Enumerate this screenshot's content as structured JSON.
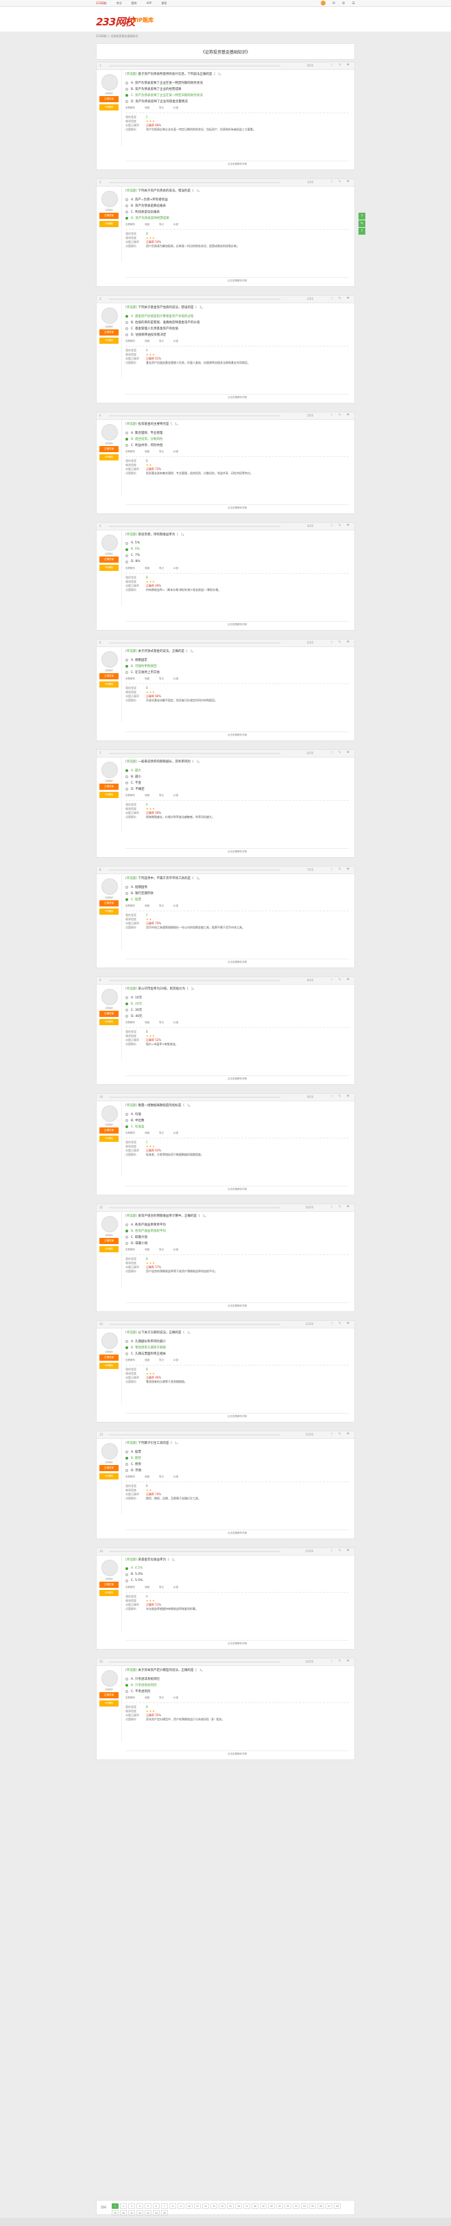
{
  "topbar": {
    "links": [
      "233网校",
      "考试",
      "题库",
      "APP",
      "课程"
    ],
    "active_index": 0
  },
  "header": {
    "logo": "233网校",
    "sublogo": "VIP题库"
  },
  "breadcrumb": "233网校 > 证券投资基金基础知识",
  "paper_title": "《证券投资基金基础知识》",
  "side_tools": [
    "↑",
    "✎",
    "?"
  ],
  "colors": {
    "brand": "#d6281c",
    "accent": "#ff7a00",
    "correct": "#4aa53a"
  },
  "labels": {
    "my_answer": "我的答案",
    "difficulty": "难易程度",
    "analysis": "试题解析",
    "correct_rate": "本题正确率",
    "view_analysis": "查看解析",
    "collect": "收藏",
    "note": "笔记",
    "error": "纠错",
    "more": "点击查看解析详情",
    "pages": "页码",
    "badge1": "正确答案",
    "badge2": "VIP解析"
  },
  "questions": [
    {
      "no": "1",
      "count": "0/50",
      "type": "[单选题]",
      "title": "基于资产负债表所提供的会计信息，下列说法正确的是（　）。",
      "options": [
        "A. 资产负债表反映了企业在某一特定时期的财务状况",
        "B. 资产负债表反映了企业的经营成果",
        "C. 资产负债表反映了企业在某一特定日期的财务状况",
        "D. 资产负债表反映了企业的现金流量情况"
      ],
      "correct": 2,
      "answer": "C",
      "stars": "★★★",
      "rate": "正确率 68%",
      "analysis": "资产负债表反映企业在某一特定日期的财务状况，包括资产、负债和所有者权益三大要素。"
    },
    {
      "no": "2",
      "count": "1/50",
      "type": "[单选题]",
      "title": "下列关于资产负债表的说法，错误的是（　）。",
      "options": [
        "A. 资产=负债+所有者权益",
        "B. 资产负债表是静态报表",
        "C. 利润表是动态报表",
        "D. 资产负债表反映经营成果"
      ],
      "correct": 3,
      "answer": "D",
      "stars": "★★★",
      "rate": "正确率 54%",
      "analysis": "资产负债表为静态报表，反映某一时点的财务状况；经营成果由利润表反映。"
    },
    {
      "no": "3",
      "count": "2/50",
      "type": "[单选题]",
      "title": "下列关于基金资产估值的说法，错误的是（　）。",
      "options": [
        "A. 基金资产估值是指计算基金资产净值的过程",
        "B. 估值的目的是客观、准确地反映基金资产的价值",
        "C. 基金管理人负责基金资产的估值",
        "D. 估值频率由投资者决定"
      ],
      "correct": 0,
      "answer": "A",
      "stars": "★★★",
      "rate": "正确率 61%",
      "analysis": "基金资产估值由基金管理人负责，托管人复核，估值频率由相关法规和基金合同规定。"
    },
    {
      "no": "4",
      "count": "3/50",
      "type": "[单选题]",
      "title": "投资基金的主要特点是（　）。",
      "options": [
        "A. 集合理财、专业管理",
        "B. 组合投资、分散风险",
        "C. 利益共享、风险共担"
      ],
      "correct": 1,
      "answer": "B",
      "stars": "★★",
      "rate": "正确率 72%",
      "analysis": "投资基金具有集合理财、专业管理，组合投资、分散风险，利益共享、风险共担等特点。"
    },
    {
      "no": "5",
      "count": "4/50",
      "type": "[单选题]",
      "title": "某投资者，持有期收益率为（　）。",
      "options": [
        "A. 5%",
        "B. 6%",
        "C. 7%",
        "D. 8%"
      ],
      "correct": 1,
      "answer": "B",
      "stars": "★★★",
      "rate": "正确率 49%",
      "analysis": "持有期收益率=（期末价格-期初价格+现金收益）/期初价格。"
    },
    {
      "no": "6",
      "count": "5/50",
      "type": "[单选题]",
      "title": "关于开放式基金的说法，正确的是（　）。",
      "options": [
        "A. 规模固定",
        "B. 可随时申购赎回",
        "C. 在交易所上市交易"
      ],
      "correct": 1,
      "answer": "B",
      "stars": "★★★",
      "rate": "正确率 66%",
      "analysis": "开放式基金份额不固定，投资者可在规定时间内申购赎回。"
    },
    {
      "no": "7",
      "count": "6/50",
      "type": "[单选题]",
      "title": "一般来说债券的期限越长，其利率风险（　）。",
      "options": [
        "A. 越大",
        "B. 越小",
        "C. 不变",
        "D. 不确定"
      ],
      "correct": 0,
      "answer": "A",
      "stars": "★★★",
      "rate": "正确率 58%",
      "analysis": "债券期限越长，价格对利率变动越敏感，利率风险越大。"
    },
    {
      "no": "8",
      "count": "7/50",
      "type": "[单选题]",
      "title": "下列选项中，不属于货币市场工具的是（　）。",
      "options": [
        "A. 短期国债",
        "B. 银行定期存款",
        "C. 股票"
      ],
      "correct": 2,
      "answer": "C",
      "stars": "★★",
      "rate": "正确率 70%",
      "analysis": "货币市场工具通常指期限在一年以内的短期金融工具，股票不属于货币市场工具。"
    },
    {
      "no": "9",
      "count": "8/50",
      "type": "[单选题]",
      "title": "某公司市盈率为20倍，则其股价为（　）。",
      "options": [
        "A. 10元",
        "B. 20元",
        "C. 30元",
        "D. 40元"
      ],
      "correct": 1,
      "answer": "B",
      "stars": "★★★",
      "rate": "正确率 52%",
      "analysis": "股价=市盈率×每股收益。"
    },
    {
      "no": "10",
      "count": "9/50",
      "type": "[单选题]",
      "title": "衡量一组数据离散程度的指标是（　）。",
      "options": [
        "A. 均值",
        "B. 中位数",
        "C. 标准差"
      ],
      "correct": 2,
      "answer": "C",
      "stars": "★★★",
      "rate": "正确率 63%",
      "analysis": "标准差、方差等指标用于衡量数据的离散程度。"
    },
    {
      "no": "11",
      "count": "10/50",
      "type": "[单选题]",
      "title": "某资产组合的预期收益率计算中，正确的是（　）。",
      "options": [
        "A. 各资产收益率简单平均",
        "B. 各资产收益率加权平均",
        "C. 取最大值",
        "D. 取最小值"
      ],
      "correct": 1,
      "answer": "B",
      "stars": "★★★",
      "rate": "正确率 57%",
      "analysis": "资产组合的预期收益率等于各资产预期收益率的加权平均。"
    },
    {
      "no": "12",
      "count": "11/50",
      "type": "[单选题]",
      "title": "以下关于久期的说法，正确的是（　）。",
      "options": [
        "A. 久期越长利率风险越小",
        "B. 零息债券久期等于期限",
        "C. 久期与票面利率正相关"
      ],
      "correct": 1,
      "answer": "B",
      "stars": "★★★",
      "rate": "正确率 46%",
      "analysis": "零息债券的久期等于其到期期限。"
    },
    {
      "no": "13",
      "count": "12/50",
      "type": "[单选题]",
      "title": "下列属于衍生工具的是（　）。",
      "options": [
        "A. 股票",
        "B. 期货",
        "C. 债券",
        "D. 存款"
      ],
      "correct": 1,
      "answer": "B",
      "stars": "★★",
      "rate": "正确率 74%",
      "analysis": "期货、期权、远期、互换属于金融衍生工具。"
    },
    {
      "no": "14",
      "count": "13/50",
      "type": "[单选题]",
      "title": "某基金年化收益率为（　）。",
      "options": [
        "A. 4.5%",
        "B. 5.0%",
        "C. 5.5%"
      ],
      "correct": 0,
      "answer": "A",
      "stars": "★★★",
      "rate": "正确率 51%",
      "analysis": "年化收益率根据持有期收益率按复利折算。"
    },
    {
      "no": "15",
      "count": "14/50",
      "type": "[单选题]",
      "title": "关于资本资产定价模型的说法，正确的是（　）。",
      "options": [
        "A. 只考虑非系统风险",
        "B. 只考虑系统风险",
        "C. 不考虑风险"
      ],
      "correct": 1,
      "answer": "B",
      "stars": "★★★",
      "rate": "正确率 55%",
      "analysis": "资本资产定价模型中，资产的预期收益只与系统风险（β）相关。"
    }
  ],
  "pager": {
    "pages": [
      "1",
      "2",
      "3",
      "4",
      "5",
      "6",
      "7",
      "8",
      "9",
      "10",
      "11",
      "12",
      "13",
      "14",
      "15",
      "16",
      "17",
      "18",
      "19",
      "20",
      "21",
      "22",
      "23",
      "24",
      "25",
      "26",
      "27",
      "28",
      "29",
      "30",
      "31",
      "32",
      "33",
      "34",
      "35"
    ],
    "current": 0
  }
}
